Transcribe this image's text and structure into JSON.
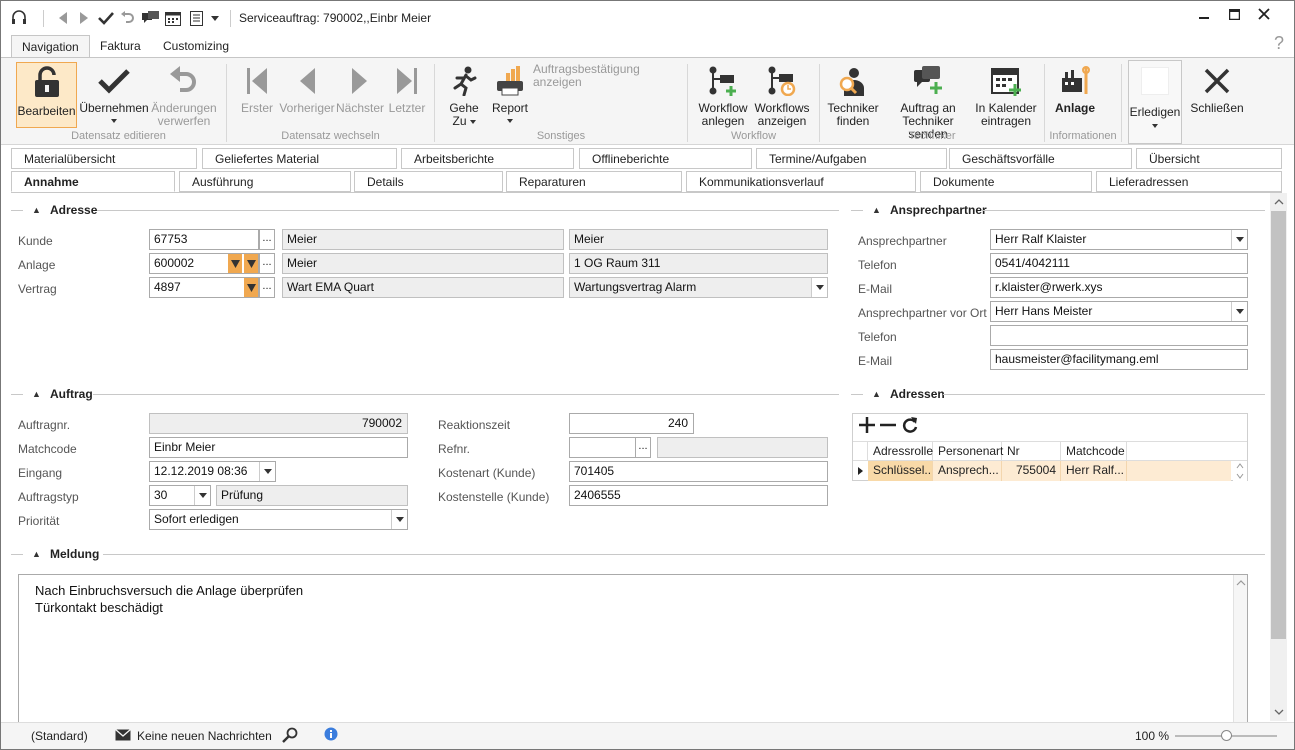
{
  "window": {
    "title": "Serviceauftrag: 790002,,Einbr Meier"
  },
  "ribbon_tabs": [
    "Navigation",
    "Faktura",
    "Customizing"
  ],
  "help": "?",
  "ribbon": {
    "bearbeiten": "Bearbeiten",
    "uebernehmen": "Übernehmen",
    "aenderungen1": "Änderungen",
    "aenderungen2": "verwerfen",
    "erster": "Erster",
    "vorheriger": "Vorheriger",
    "naechster": "Nächster",
    "letzter": "Letzter",
    "gehe1": "Gehe",
    "gehe2": "Zu",
    "report": "Report",
    "auftragsbest": "Auftragsbestätigung anzeigen",
    "wfanlegen1": "Workflow",
    "wfanlegen2": "anlegen",
    "wfanzeigen1": "Workflows",
    "wfanzeigen2": "anzeigen",
    "techfinden1": "Techniker",
    "techfinden2": "finden",
    "auftragsenden1": "Auftrag an",
    "auftragsenden2": "Techniker senden",
    "kalender1": "In Kalender",
    "kalender2": "eintragen",
    "anlage": "Anlage",
    "erledigen": "Erledigen",
    "schliessen": "Schließen",
    "groups": {
      "datensatz_editieren": "Datensatz editieren",
      "datensatz_wechseln": "Datensatz wechseln",
      "sonstiges": "Sonstiges",
      "workflow": "Workflow",
      "techniker": "Techniker",
      "informationen": "Informationen"
    }
  },
  "form_tabs_row1": [
    "Materialübersicht",
    "Geliefertes Material",
    "Arbeitsberichte",
    "Offlineberichte",
    "Termine/Aufgaben",
    "Geschäftsvorfälle",
    "Übersicht"
  ],
  "form_tabs_row2": [
    "Annahme",
    "Ausführung",
    "Details",
    "Reparaturen",
    "Kommunikationsverlauf",
    "Dokumente",
    "Lieferadressen"
  ],
  "adresse": {
    "section": "Adresse",
    "kunde_label": "Kunde",
    "kunde": "67753",
    "kunde_name1": "Meier",
    "kunde_name2": "Meier",
    "anlage_label": "Anlage",
    "anlage": "600002",
    "anlage_name": "Meier",
    "anlage_ort": "1 OG Raum 311",
    "vertrag_label": "Vertrag",
    "vertrag": "4897",
    "vertrag_name": "Wart EMA Quart",
    "vertrag_typ": "Wartungsvertrag Alarm",
    "dots": "..."
  },
  "ansprechpartner": {
    "section": "Ansprechpartner",
    "ap_label": "Ansprechpartner",
    "ap": "Herr Ralf Klaister",
    "tel_label": "Telefon",
    "tel": "0541/4042111",
    "mail_label": "E-Mail",
    "mail": "r.klaister@rwerk.xys",
    "apvo_label": "Ansprechpartner vor Ort",
    "apvo": "Herr Hans Meister",
    "tel2_label": "Telefon",
    "tel2": "",
    "mail2_label": "E-Mail",
    "mail2": "hausmeister@facilitymang.eml"
  },
  "auftrag": {
    "section": "Auftrag",
    "nr_label": "Auftragnr.",
    "nr": "790002",
    "match_label": "Matchcode",
    "match": "Einbr Meier",
    "eingang_label": "Eingang",
    "eingang": "12.12.2019 08:36",
    "typ_label": "Auftragstyp",
    "typ": "30",
    "typ_name": "Prüfung",
    "prio_label": "Priorität",
    "prio": "Sofort erledigen",
    "reakt_label": "Reaktionszeit",
    "reakt": "240",
    "refnr_label": "Refnr.",
    "refnr": "",
    "kostenart_label": "Kostenart (Kunde)",
    "kostenart": "701405",
    "kostenstelle_label": "Kostenstelle (Kunde)",
    "kostenstelle": "2406555"
  },
  "adressen": {
    "section": "Adressen",
    "columns": [
      "Adressrolle",
      "Personenart",
      "Nr",
      "Matchcode"
    ],
    "row": [
      "Schlüssel...",
      "Ansprech...",
      "755004",
      "Herr Ralf..."
    ]
  },
  "meldung": {
    "section": "Meldung",
    "line1": "Nach Einbruchsversuch die Anlage überprüfen",
    "line2": "Türkontakt beschädigt"
  },
  "status": {
    "layout": "(Standard)",
    "messages": "Keine neuen Nachrichten",
    "zoom": "100 %",
    "zoom_level": 0.5
  },
  "colors": {
    "accent": "#f0a850",
    "selected_row": "#fdebd3",
    "ribbon_bg": "#f5f5f5"
  }
}
